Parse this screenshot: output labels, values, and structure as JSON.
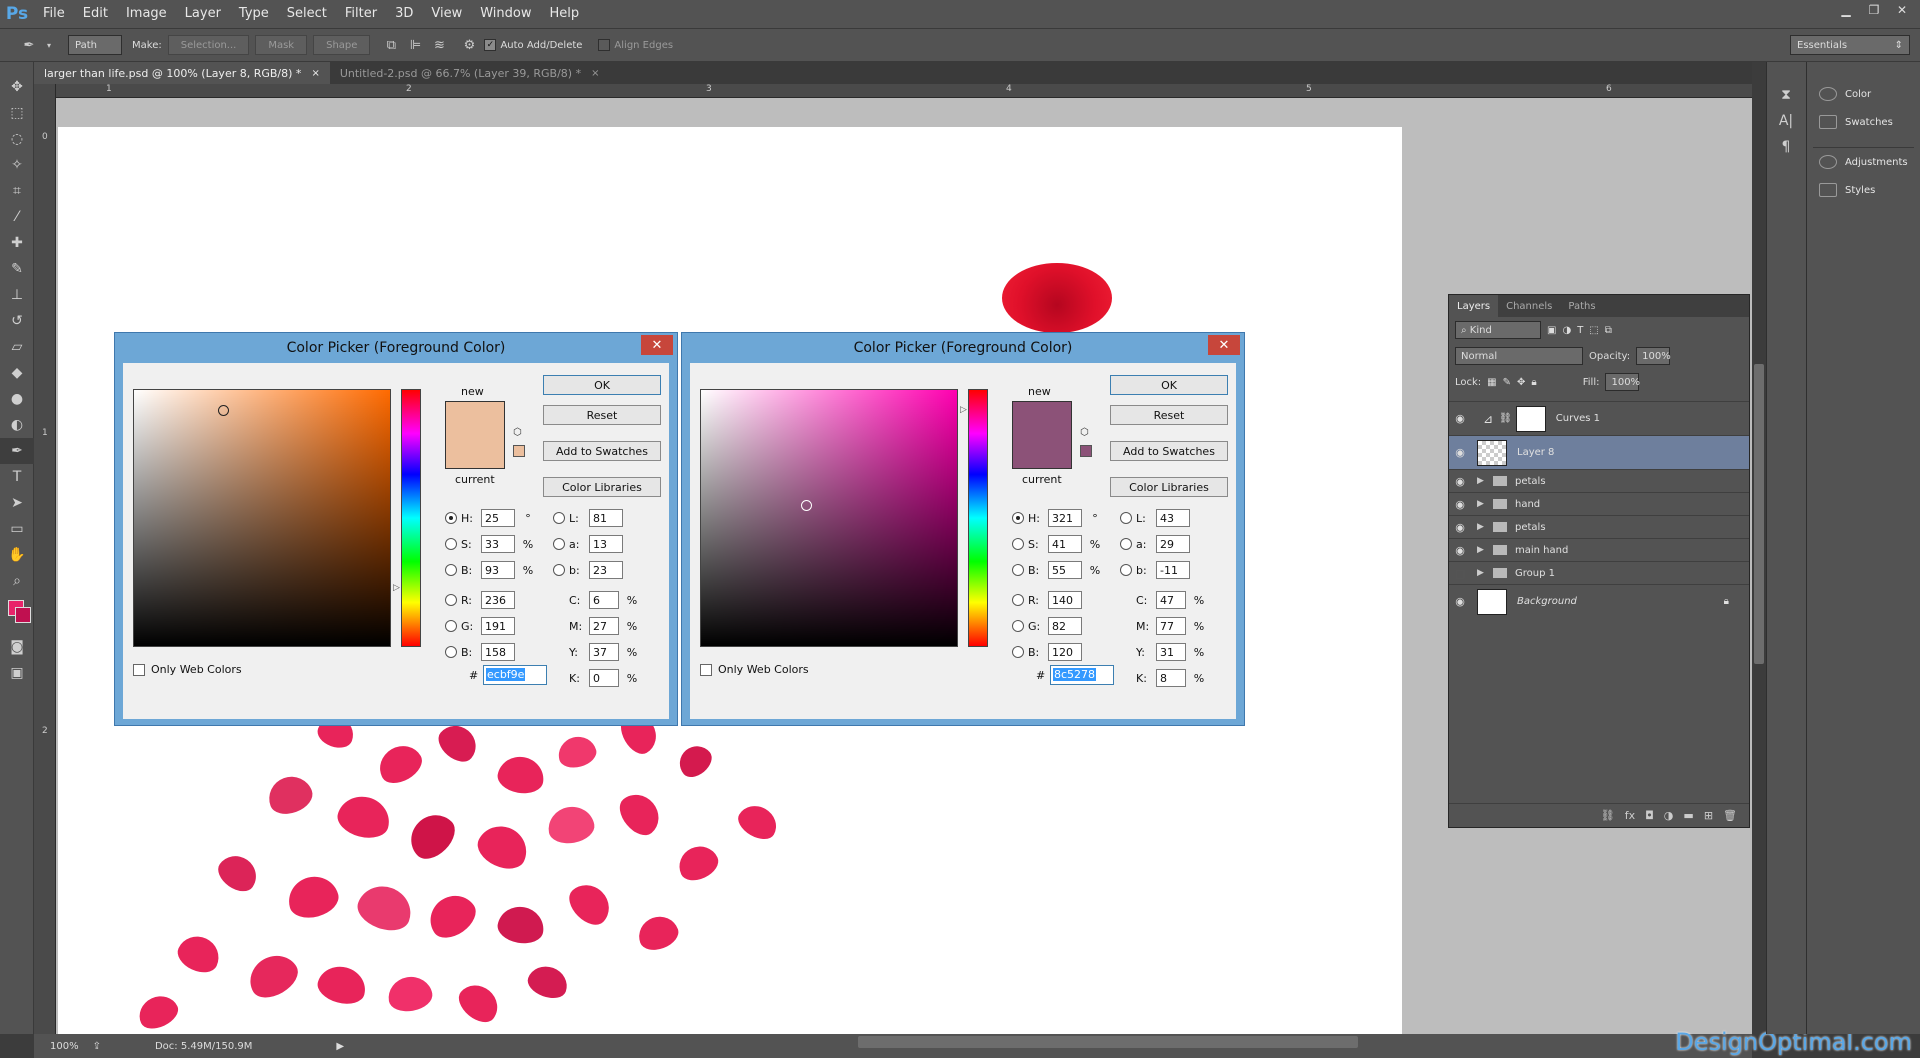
{
  "app": {
    "logo": "Ps"
  },
  "menu": [
    "File",
    "Edit",
    "Image",
    "Layer",
    "Type",
    "Select",
    "Filter",
    "3D",
    "View",
    "Window",
    "Help"
  ],
  "options": {
    "tool_mode": "Path",
    "make_label": "Make:",
    "selection_btn": "Selection...",
    "mask_btn": "Mask",
    "shape_btn": "Shape",
    "auto_add_delete": "Auto Add/Delete",
    "align_edges": "Align Edges",
    "workspace": "Essentials"
  },
  "tabs": [
    {
      "label": "larger than life.psd @ 100% (Layer 8, RGB/8) *"
    },
    {
      "label": "Untitled-2.psd @ 66.7% (Layer 39, RGB/8) *"
    }
  ],
  "ruler": {
    "h": [
      "1",
      "2",
      "3",
      "4",
      "5",
      "6"
    ],
    "v": [
      "0",
      "1",
      "2"
    ]
  },
  "status": {
    "zoom": "100%",
    "doc": "Doc: 5.49M/150.9M"
  },
  "watermark": "DesignOptimal.com",
  "right_mini": [
    {
      "label": "Color",
      "icon": "color-wheel-icon"
    },
    {
      "label": "Swatches",
      "icon": "swatches-grid-icon"
    },
    {
      "label": "Adjustments",
      "icon": "adjustments-icon"
    },
    {
      "label": "Styles",
      "icon": "fx-styles-icon"
    }
  ],
  "layers_panel": {
    "tabs": [
      "Layers",
      "Channels",
      "Paths"
    ],
    "kind": "Kind",
    "blend": "Normal",
    "opacity_label": "Opacity:",
    "opacity": "100%",
    "lock_label": "Lock:",
    "fill_label": "Fill:",
    "fill": "100%",
    "layers": [
      {
        "name": "Curves 1",
        "type": "adjustment"
      },
      {
        "name": "Layer 8",
        "type": "pixel"
      },
      {
        "name": "petals",
        "type": "group"
      },
      {
        "name": "hand",
        "type": "group"
      },
      {
        "name": "petals",
        "type": "group"
      },
      {
        "name": "main hand",
        "type": "group"
      },
      {
        "name": "Group 1",
        "type": "group"
      },
      {
        "name": "Background",
        "type": "background"
      }
    ]
  },
  "dialogs": [
    {
      "title": "Color Picker (Foreground Color)",
      "new_label": "new",
      "current_label": "current",
      "new_color": "#ecbf9e",
      "current_color": "#ecbf9e",
      "hue_base": "#ff6a00",
      "buttons": {
        "ok": "OK",
        "reset": "Reset",
        "add": "Add to Swatches",
        "libs": "Color Libraries"
      },
      "H": "25",
      "S": "33",
      "Bv": "93",
      "R": "236",
      "G": "191",
      "B": "158",
      "L": "81",
      "a": "13",
      "b": "23",
      "C": "6",
      "M": "27",
      "Y": "37",
      "K": "0",
      "hex": "ecbf9e",
      "web_colors": "Only Web Colors"
    },
    {
      "title": "Color Picker (Foreground Color)",
      "new_label": "new",
      "current_label": "current",
      "new_color": "#8c5278",
      "current_color": "#8c5278",
      "hue_base": "#ff00b0",
      "buttons": {
        "ok": "OK",
        "reset": "Reset",
        "add": "Add to Swatches",
        "libs": "Color Libraries"
      },
      "H": "321",
      "S": "41",
      "Bv": "55",
      "R": "140",
      "G": "82",
      "B": "120",
      "L": "43",
      "a": "29",
      "b": "-11",
      "C": "47",
      "M": "77",
      "Y": "31",
      "K": "8",
      "hex": "8c5278",
      "web_colors": "Only Web Colors"
    }
  ],
  "colors": {
    "accent": "#5ba8e8",
    "foreground": "#e8246a",
    "background_swatch": "#c01050"
  }
}
